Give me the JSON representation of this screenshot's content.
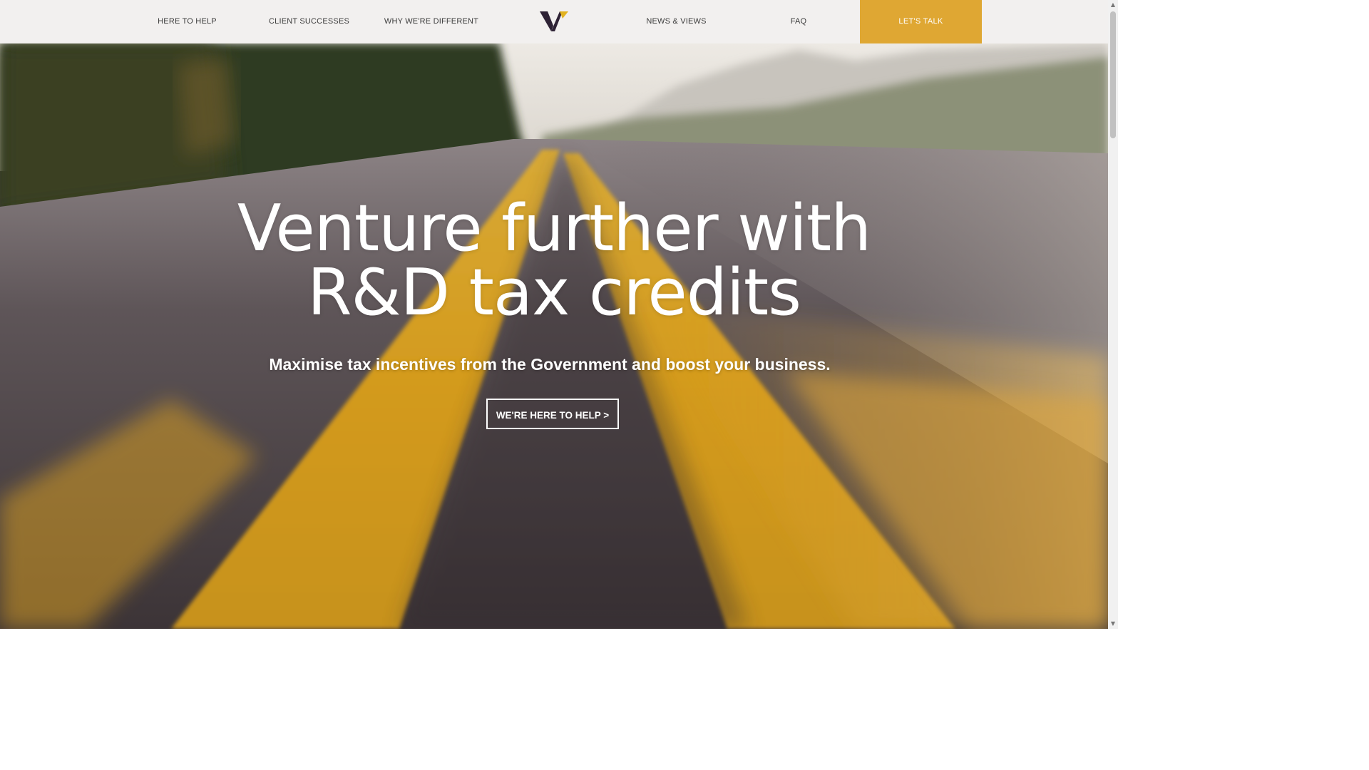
{
  "nav": {
    "items": [
      {
        "label": "HERE TO HELP"
      },
      {
        "label": "CLIENT SUCCESSES"
      },
      {
        "label": "WHY WE'RE DIFFERENT"
      },
      {
        "label": "NEWS & VIEWS"
      },
      {
        "label": "FAQ"
      }
    ],
    "cta_label": "LET'S TALK",
    "logo_icon": "v-logo-icon"
  },
  "hero": {
    "headline_line1": "Venture further with",
    "headline_line2": "R&D tax credits",
    "subheadline": "Maximise tax incentives from the Government and boost your business.",
    "cta_label": "WE'RE HERE TO HELP >"
  },
  "colors": {
    "accent": "#dfa733",
    "nav_bg": "#f2f0ef",
    "logo_dark": "#2e2235",
    "text_light": "#ffffff"
  },
  "scrollbar": {
    "up_icon": "chevron-up-icon",
    "down_icon": "chevron-down-icon"
  }
}
